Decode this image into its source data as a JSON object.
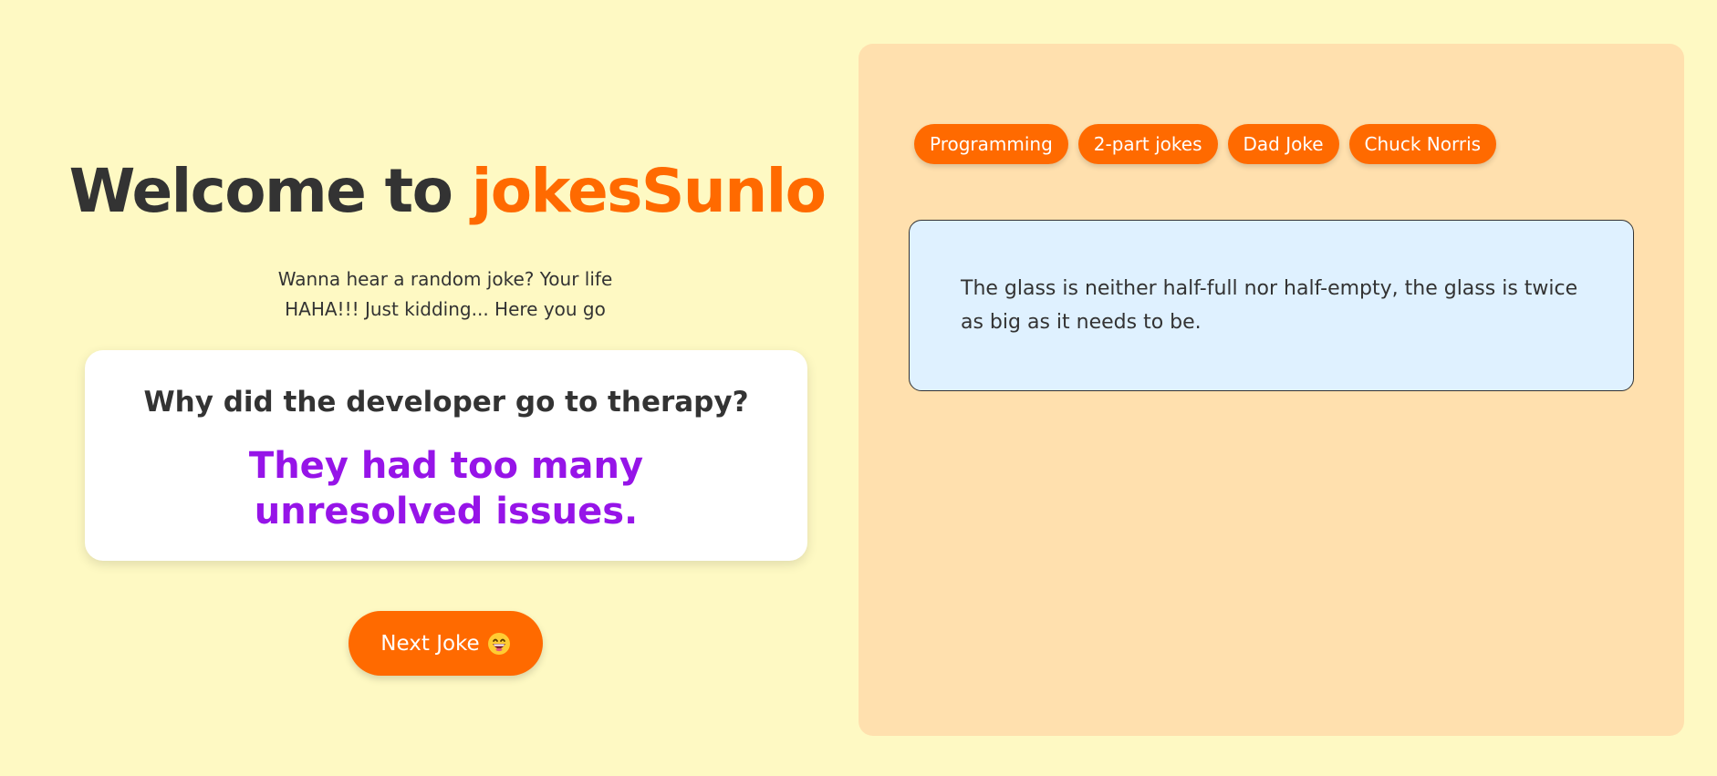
{
  "header": {
    "welcome_prefix": "Welcome to ",
    "brand": "jokesSunlo"
  },
  "subtitle": {
    "line1": "Wanna hear a random joke? Your life",
    "line2": "HAHA!!! Just kidding... Here you go"
  },
  "joke_card": {
    "setup": "Why did the developer go to therapy?",
    "delivery": "They had too many unresolved issues."
  },
  "next_button": {
    "label": "Next Joke",
    "icon": "grinning-face-emoji"
  },
  "categories": [
    {
      "label": "Programming"
    },
    {
      "label": "2-part jokes"
    },
    {
      "label": "Dad Joke"
    },
    {
      "label": "Chuck Norris"
    }
  ],
  "joke_box": {
    "text": "The glass is neither half-full nor half-empty, the glass is twice as big as it needs to be."
  },
  "colors": {
    "background": "#fef9c3",
    "accent": "#ff6a00",
    "delivery_text": "#9614e8",
    "panel": "#ffe0ae",
    "joke_box": "#dff1ff"
  }
}
